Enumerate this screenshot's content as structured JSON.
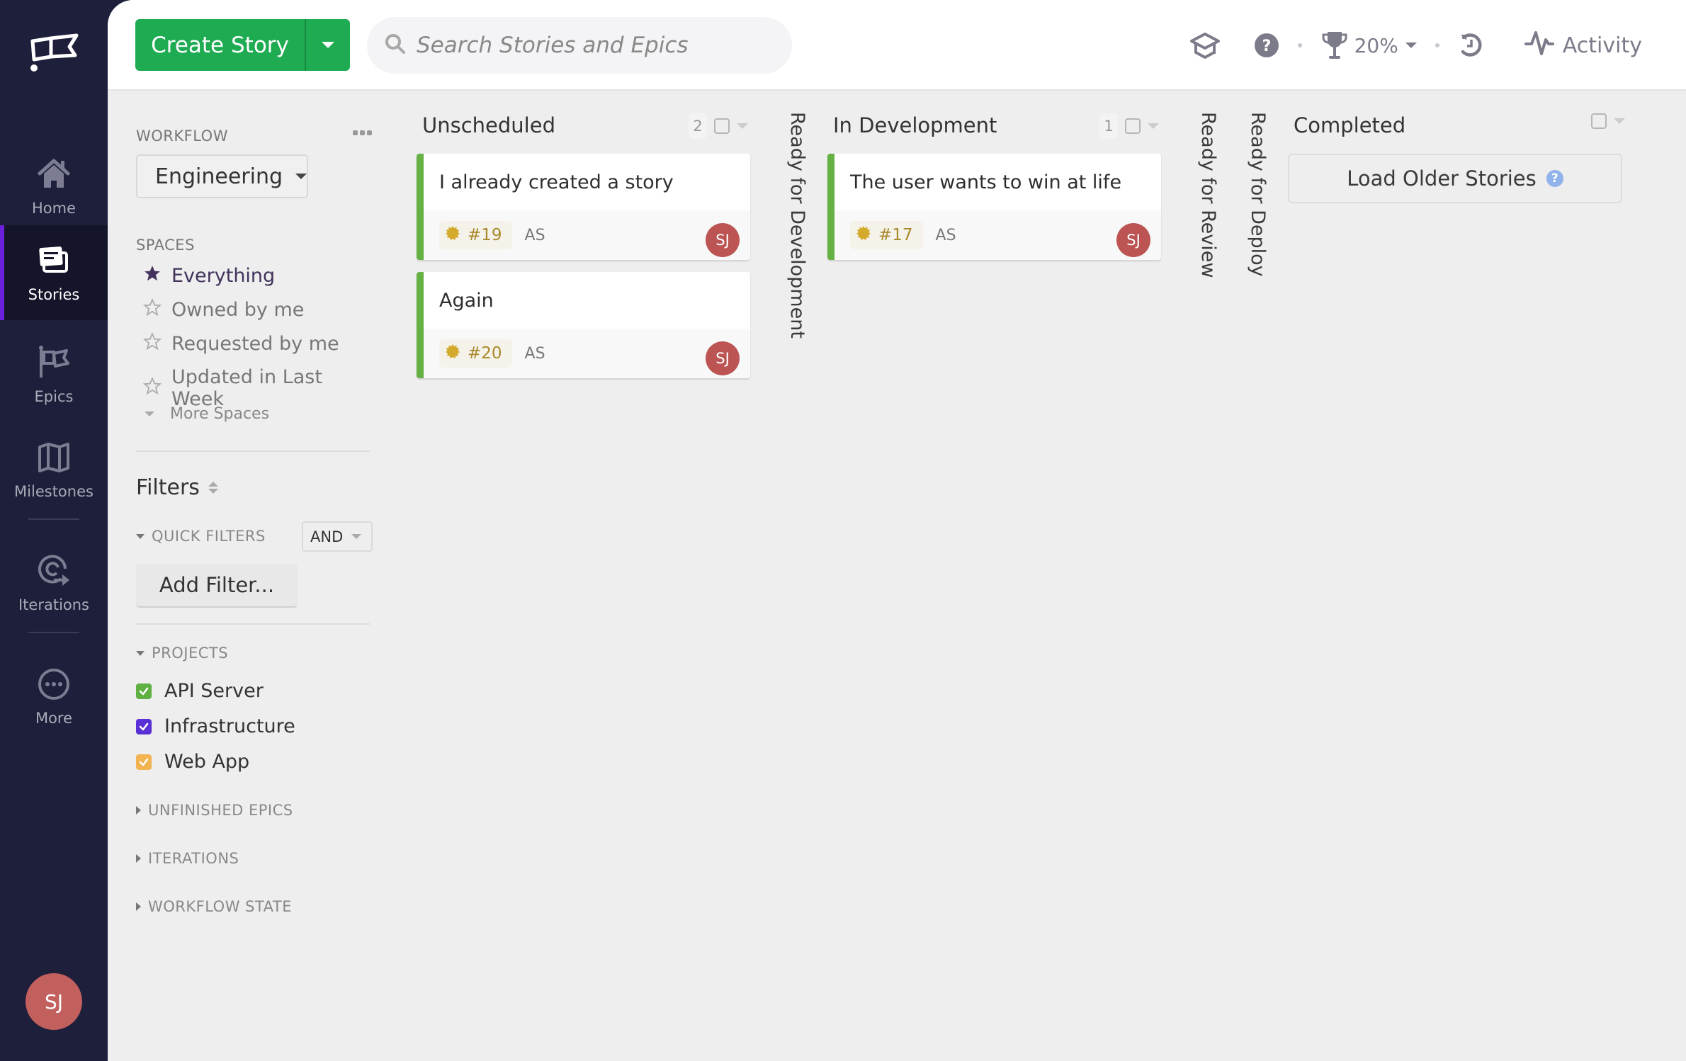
{
  "nav": {
    "items": [
      {
        "label": "Home",
        "icon": "home-icon"
      },
      {
        "label": "Stories",
        "icon": "stories-icon",
        "active": true
      },
      {
        "label": "Epics",
        "icon": "epics-flag-icon"
      },
      {
        "label": "Milestones",
        "icon": "map-icon"
      },
      {
        "label": "Iterations",
        "icon": "iterations-icon"
      },
      {
        "label": "More",
        "icon": "more-icon"
      }
    ],
    "user_initials": "SJ",
    "active_color": "#6c20db"
  },
  "topbar": {
    "create_label": "Create Story",
    "search_placeholder": "Search Stories and Epics",
    "progress_value": "20%",
    "activity_label": "Activity"
  },
  "panel": {
    "workflow_label": "WORKFLOW",
    "workflow_value": "Engineering",
    "spaces_label": "SPACES",
    "spaces": [
      {
        "label": "Everything",
        "active": true
      },
      {
        "label": "Owned by me",
        "active": false
      },
      {
        "label": "Requested by me",
        "active": false
      },
      {
        "label": "Updated in Last Week",
        "active": false
      }
    ],
    "more_spaces": "More Spaces",
    "filters_title": "Filters",
    "quick_filters_label": "QUICK FILTERS",
    "operator": "AND",
    "add_filter_label": "Add Filter...",
    "projects_label": "PROJECTS",
    "projects": [
      {
        "label": "API Server",
        "color": "#5fb043",
        "checked": true
      },
      {
        "label": "Infrastructure",
        "color": "#5930d6",
        "checked": true
      },
      {
        "label": "Web App",
        "color": "#f2b351",
        "checked": true
      }
    ],
    "collapsed_sections": [
      "UNFINISHED EPICS",
      "ITERATIONS",
      "WORKFLOW STATE"
    ]
  },
  "board": {
    "columns": [
      {
        "name": "Unscheduled",
        "count": "2",
        "cards": [
          {
            "title": "I already created a story",
            "id": "#19",
            "requester": "AS",
            "owner": "SJ"
          },
          {
            "title": "Again",
            "id": "#20",
            "requester": "AS",
            "owner": "SJ"
          }
        ]
      },
      {
        "name": "Ready for Development",
        "collapsed": true
      },
      {
        "name": "In Development",
        "count": "1",
        "cards": [
          {
            "title": "The user wants to win at life",
            "id": "#17",
            "requester": "AS",
            "owner": "SJ"
          }
        ]
      },
      {
        "name": "Ready for Review",
        "collapsed": true
      },
      {
        "name": "Ready for Deploy",
        "collapsed": true
      },
      {
        "name": "Completed",
        "load_older_label": "Load Older Stories"
      }
    ],
    "card_accent": "#66b144",
    "feature_color": "#d4aa2c"
  }
}
